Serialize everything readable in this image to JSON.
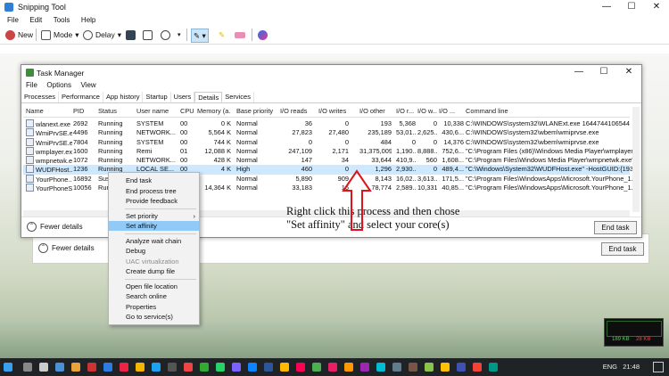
{
  "snipping_tool": {
    "title": "Snipping Tool",
    "menu": [
      "File",
      "Edit",
      "Tools",
      "Help"
    ],
    "toolbar": {
      "new": "New",
      "mode": "Mode",
      "delay": "Delay"
    }
  },
  "task_manager": {
    "title": "Task Manager",
    "menu": [
      "File",
      "Options",
      "View"
    ],
    "tabs": [
      "Processes",
      "Performance",
      "App history",
      "Startup",
      "Users",
      "Details",
      "Services"
    ],
    "active_tab": "Details",
    "columns": [
      "Name",
      "PID",
      "Status",
      "User name",
      "CPU",
      "Memory (a...",
      "Base priority",
      "I/O reads",
      "I/O writes",
      "I/O other",
      "I/O r...",
      "I/O w...",
      "I/O ...",
      "Command line"
    ],
    "rows": [
      [
        "wlanext.exe",
        "2692",
        "Running",
        "SYSTEM",
        "00",
        "0 K",
        "Normal",
        "36",
        "0",
        "193",
        "5,368",
        "0",
        "10,338",
        "C:\\WINDOWS\\system32\\WLANExt.exe 1644744106544"
      ],
      [
        "WmiPrvSE.exe",
        "4496",
        "Running",
        "NETWORK...",
        "00",
        "5,564 K",
        "Normal",
        "27,823",
        "27,480",
        "235,189",
        "53,01...",
        "2,625...",
        "430,6...",
        "C:\\WINDOWS\\system32\\wbem\\wmiprvse.exe"
      ],
      [
        "WmiPrvSE.e...",
        "7804",
        "Running",
        "SYSTEM",
        "00",
        "744 K",
        "Normal",
        "0",
        "0",
        "484",
        "0",
        "0",
        "14,376",
        "C:\\WINDOWS\\system32\\wbem\\wmiprvse.exe"
      ],
      [
        "wmplayer.exe",
        "1600",
        "Running",
        "Remi",
        "01",
        "12,088 K",
        "Normal",
        "247,109",
        "2,171",
        "31,375,009",
        "1,190...",
        "8,888...",
        "752,6...",
        "\"C:\\Program Files (x86)\\Windows Media Player\\wmplayer.exe\""
      ],
      [
        "wmpnetwk.e...",
        "1072",
        "Running",
        "NETWORK...",
        "00",
        "428 K",
        "Normal",
        "147",
        "34",
        "33,644",
        "410,9...",
        "560",
        "1,608...",
        "\"C:\\Program Files\\Windows Media Player\\wmpnetwk.exe\""
      ],
      [
        "WUDFHost...",
        "1236",
        "Running",
        "LOCAL SE...",
        "00",
        "4 K",
        "High",
        "460",
        "0",
        "1,296",
        "2,930...",
        "0",
        "489,4...",
        "\"C:\\Windows\\System32\\WUDFHost.exe\" -HostGUID:{193a1820..."
      ],
      [
        "YourPhone...",
        "16892",
        "Suspe...",
        "",
        "",
        "",
        "Normal",
        "5,890",
        "909",
        "8,143",
        "16,02...",
        "3,613...",
        "171,5...",
        "\"C:\\Program Files\\WindowsApps\\Microsoft.YourPhone_1.2108..."
      ],
      [
        "YourPhoneS...",
        "10056",
        "Runni...",
        "",
        "",
        "14,364 K",
        "Normal",
        "33,183",
        "16",
        "78,774",
        "2,589...",
        "10,331",
        "40,85...",
        "\"C:\\Program Files\\WindowsApps\\Microsoft.YourPhone_1.2108..."
      ]
    ],
    "selected_row": 5,
    "fewer_details": "Fewer details",
    "end_task": "End task"
  },
  "context_menu": {
    "items": [
      {
        "label": "End task",
        "disabled": false
      },
      {
        "label": "End process tree",
        "disabled": false
      },
      {
        "label": "Provide feedback",
        "disabled": false
      },
      {
        "sep": true
      },
      {
        "label": "Set priority",
        "submenu": true
      },
      {
        "label": "Set affinity",
        "highlighted": true
      },
      {
        "sep": true
      },
      {
        "label": "Analyze wait chain"
      },
      {
        "label": "Debug"
      },
      {
        "label": "UAC virtualization",
        "disabled": true
      },
      {
        "label": "Create dump file"
      },
      {
        "sep": true
      },
      {
        "label": "Open file location"
      },
      {
        "label": "Search online"
      },
      {
        "label": "Properties"
      },
      {
        "label": "Go to service(s)"
      }
    ]
  },
  "annotation": "Right click this process and then chose \"Set affinity\" and select your core(s)",
  "background_window": {
    "fewer_details": "Fewer details",
    "end_task": "End task"
  },
  "net_widget": {
    "down": "189 KB",
    "up": "28 KB"
  },
  "tray": {
    "lang": "ENG",
    "time": "21:48"
  },
  "colors": {
    "accent_arrow": "#e0121b",
    "selection": "#cde8ff",
    "menu_highlight": "#91c9f7"
  }
}
